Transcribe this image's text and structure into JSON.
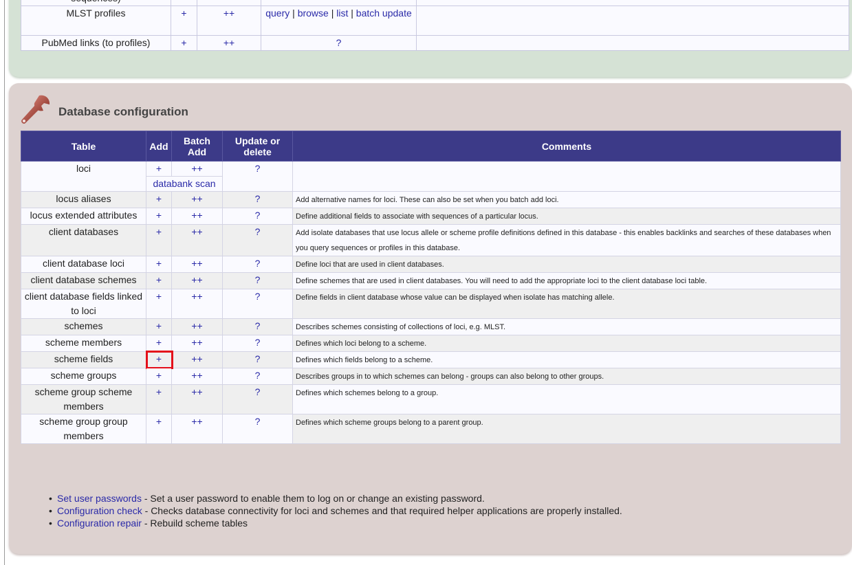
{
  "top_table": {
    "rows": [
      {
        "table": "sequences)",
        "add": "",
        "batch": "",
        "links": []
      },
      {
        "table": "MLST profiles",
        "add": "+",
        "batch": "++",
        "links": [
          "query",
          "browse",
          "list",
          "batch update"
        ]
      },
      {
        "table": "PubMed links (to profiles)",
        "add": "+",
        "batch": "++",
        "links": [
          "?"
        ]
      }
    ],
    "separator": " | "
  },
  "config": {
    "title": "Database configuration",
    "icon": "wrench-icon",
    "headers": {
      "table": "Table",
      "add": "Add",
      "batch": "Batch Add",
      "update": "Update or delete",
      "comments": "Comments"
    },
    "rows": [
      {
        "table": "loci",
        "add": "+",
        "batch": "++",
        "extra": "databank scan",
        "update": "?",
        "comment": ""
      },
      {
        "table": "locus aliases",
        "add": "+",
        "batch": "++",
        "update": "?",
        "comment": "Add alternative names for loci. These can also be set when you batch add loci."
      },
      {
        "table": "locus extended attributes",
        "add": "+",
        "batch": "++",
        "update": "?",
        "comment": "Define additional fields to associate with sequences of a particular locus."
      },
      {
        "table": "client databases",
        "add": "+",
        "batch": "++",
        "update": "?",
        "comment": "Add isolate databases that use locus allele or scheme profile definitions defined in this database - this enables backlinks and searches of these databases when you query sequences or profiles in this database."
      },
      {
        "table": "client database loci",
        "add": "+",
        "batch": "++",
        "update": "?",
        "comment": "Define loci that are used in client databases."
      },
      {
        "table": "client database schemes",
        "add": "+",
        "batch": "++",
        "update": "?",
        "comment": "Define schemes that are used in client databases. You will need to add the appropriate loci to the client database loci table."
      },
      {
        "table": "client database fields linked to loci",
        "add": "+",
        "batch": "++",
        "update": "?",
        "comment": "Define fields in client database whose value can be displayed when isolate has matching allele."
      },
      {
        "table": "schemes",
        "add": "+",
        "batch": "++",
        "update": "?",
        "comment": "Describes schemes consisting of collections of loci, e.g. MLST."
      },
      {
        "table": "scheme members",
        "add": "+",
        "batch": "++",
        "update": "?",
        "comment": "Defines which loci belong to a scheme."
      },
      {
        "table": "scheme fields",
        "add": "+",
        "batch": "++",
        "update": "?",
        "comment": "Defines which fields belong to a scheme.",
        "highlight": true
      },
      {
        "table": "scheme groups",
        "add": "+",
        "batch": "++",
        "update": "?",
        "comment": "Describes groups in to which schemes can belong - groups can also belong to other groups."
      },
      {
        "table": "scheme group scheme members",
        "add": "+",
        "batch": "++",
        "update": "?",
        "comment": "Defines which schemes belong to a group."
      },
      {
        "table": "scheme group group members",
        "add": "+",
        "batch": "++",
        "update": "?",
        "comment": "Defines which scheme groups belong to a parent group."
      }
    ],
    "highlight_color": "#e4101a"
  },
  "footer": {
    "items": [
      {
        "link": "Set user passwords",
        "text": " - Set a user password to enable them to log on or change an existing password."
      },
      {
        "link": "Configuration check",
        "text": " - Checks database connectivity for loci and schemes and that required helper applications are properly installed."
      },
      {
        "link": "Configuration repair",
        "text": " - Rebuild scheme tables"
      }
    ]
  },
  "colors": {
    "header_bg": "#3c3a88",
    "link": "#2a2aa8",
    "config_panel_bg": "#ddd2d0",
    "top_panel_bg": "#d5e2d5"
  }
}
